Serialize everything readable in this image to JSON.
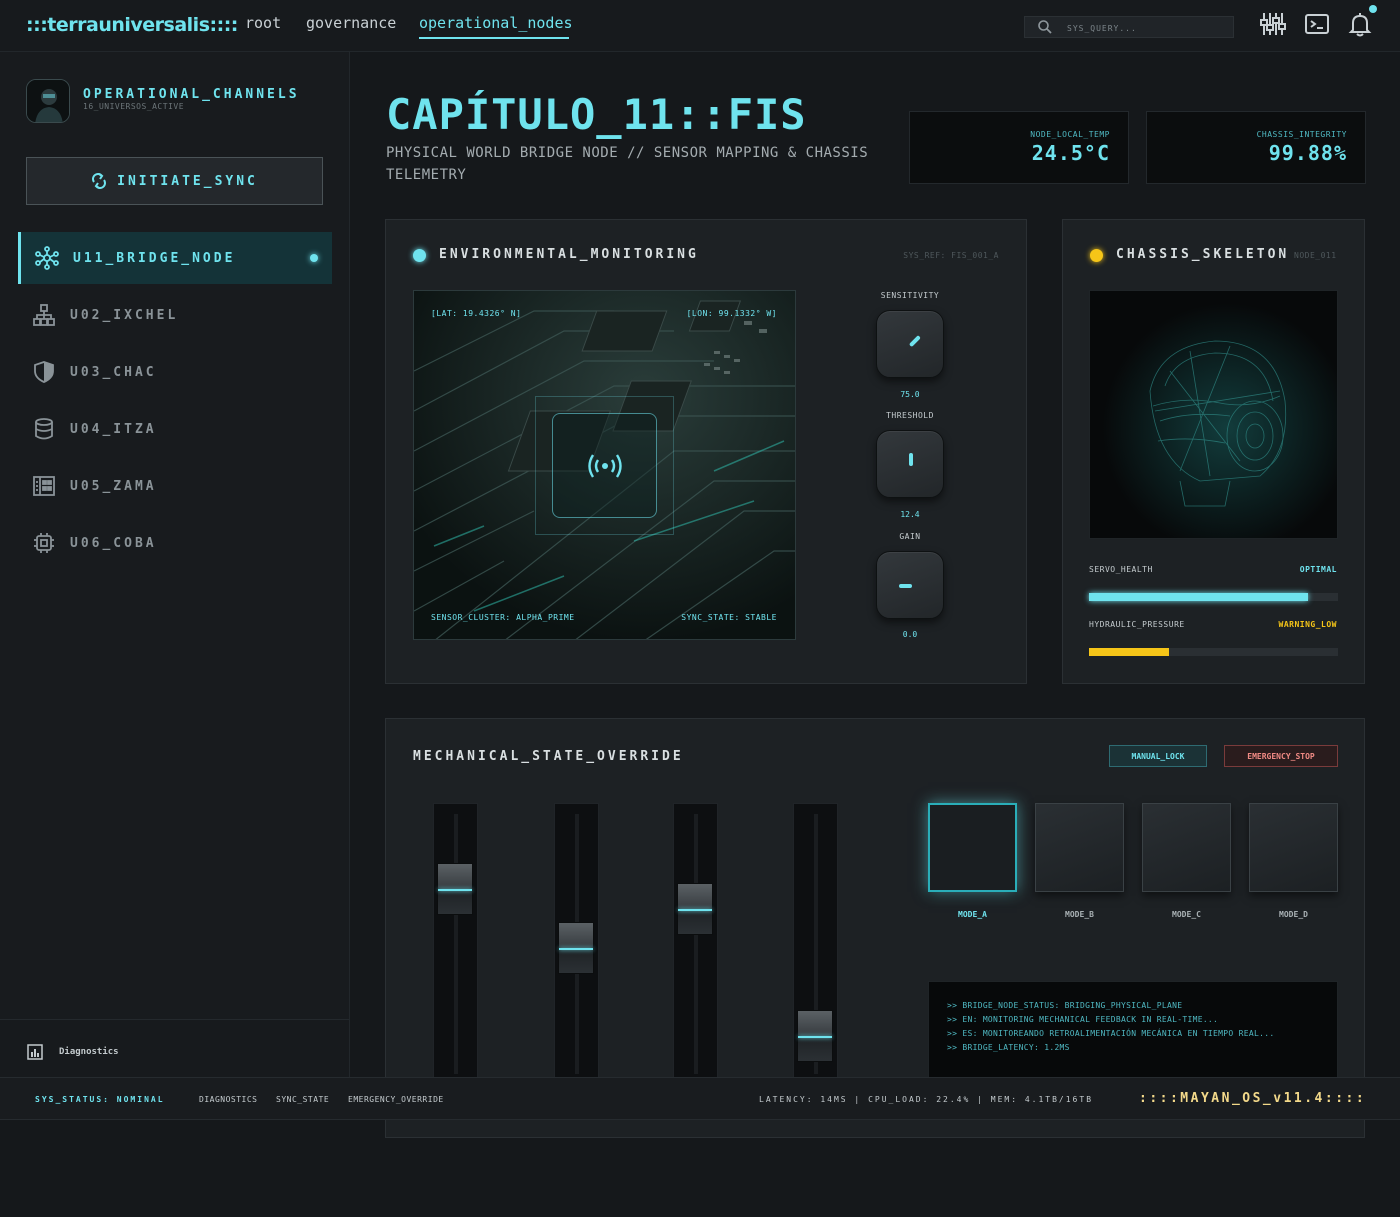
{
  "header": {
    "logo": ":::terrauniversalis::::",
    "nav": [
      "root",
      "governance",
      "operational_nodes"
    ],
    "active_nav": "operational_nodes",
    "search_placeholder": "SYS_QUERY...",
    "icons": [
      "sliders-icon",
      "terminal-icon",
      "bell-icon"
    ]
  },
  "sidebar": {
    "title": "OPERATIONAL_CHANNELS",
    "subtitle": "16_UNIVERSOS_ACTIVE",
    "sync_label": "INITIATE_SYNC",
    "items": [
      {
        "label": "U11_BRIDGE_NODE",
        "icon": "network-icon",
        "active": true
      },
      {
        "label": "U02_IXCHEL",
        "icon": "hierarchy-icon",
        "active": false
      },
      {
        "label": "U03_CHAC",
        "icon": "shield-icon",
        "active": false
      },
      {
        "label": "U04_ITZA",
        "icon": "database-icon",
        "active": false
      },
      {
        "label": "U05_ZAMA",
        "icon": "grid-calendar-icon",
        "active": false
      },
      {
        "label": "U06_COBA",
        "icon": "chip-icon",
        "active": false
      }
    ],
    "footer_label": "Diagnostics"
  },
  "page": {
    "title": "CAPÍTULO_11::FIS",
    "subtitle": "PHYSICAL WORLD BRIDGE NODE // SENSOR MAPPING & CHASSIS TELEMETRY"
  },
  "stats": [
    {
      "label": "NODE_LOCAL_TEMP",
      "value": "24.5°C"
    },
    {
      "label": "CHASSIS_INTEGRITY",
      "value": "99.88%"
    }
  ],
  "env": {
    "title": "ENVIRONMENTAL_MONITORING",
    "ref": "SYS_REF: FIS_001_A",
    "lat": "[LAT: 19.4326° N]",
    "lon": "[LON: 99.1332° W]",
    "sensor_cluster": "SENSOR_CLUSTER: ALPHA_PRIME",
    "sync_state": "SYNC_STATE: STABLE",
    "knobs": [
      {
        "label": "SENSITIVITY",
        "value": "75.0",
        "angle": 45
      },
      {
        "label": "THRESHOLD",
        "value": "12.4",
        "angle": 0
      },
      {
        "label": "GAIN",
        "value": "0.0",
        "angle": -90
      }
    ],
    "accent": "#6fe3ee"
  },
  "chassis": {
    "title": "CHASSIS_SKELETON",
    "ref": "NODE_011",
    "servo_label": "SERVO_HEALTH",
    "servo_status": "OPTIMAL",
    "servo_level": 0.88,
    "hydraulic_label": "HYDRAULIC_PRESSURE",
    "hydraulic_status": "WARNING_LOW",
    "hydraulic_level": 0.32,
    "warning_color": "#f5c518"
  },
  "mechanical": {
    "title": "MECHANICAL_STATE_OVERRIDE",
    "manual_lock": "MANUAL_LOCK",
    "emergency_stop": "EMERGENCY_STOP",
    "fader_levels": [
      0.75,
      0.48,
      0.66,
      0.08
    ],
    "modes": [
      "MODE_A",
      "MODE_B",
      "MODE_C",
      "MODE_D"
    ],
    "active_mode": "MODE_A",
    "console": [
      ">> BRIDGE_NODE_STATUS: BRIDGING_PHYSICAL_PLANE",
      ">> EN: MONITORING MECHANICAL FEEDBACK IN REAL-TIME...",
      ">> ES: MONITOREANDO RETROALIMENTACIÓN MECÁNICA EN TIEMPO REAL...",
      ">> BRIDGE_LATENCY: 1.2MS"
    ]
  },
  "statusbar": {
    "status": "SYS_STATUS: NOMINAL",
    "links": [
      "DIAGNOSTICS",
      "SYNC_STATE",
      "EMERGENCY_OVERRIDE"
    ],
    "metrics": "LATENCY: 14MS | CPU_LOAD: 22.4% | MEM: 4.1TB/16TB",
    "os": "::::MAYAN_OS_v11.4::::"
  }
}
